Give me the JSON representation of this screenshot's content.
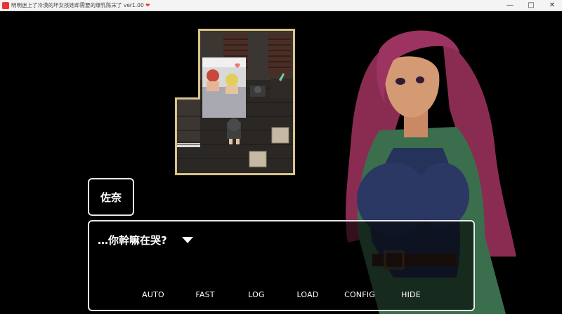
{
  "window": {
    "title": "明明迷上了冷漠的坏女孩她却需要的爆乳陈宋了 ver1.00",
    "heart": "❤",
    "minimize": "—",
    "maximize": "□",
    "close": "✕"
  },
  "dialogue": {
    "speaker": "佐奈",
    "text": "…你幹嘛在哭?"
  },
  "menu": {
    "items": [
      "AUTO",
      "FAST",
      "LOG",
      "LOAD",
      "CONFIG",
      "HIDE"
    ]
  },
  "colors": {
    "room_border": "#d8c48a",
    "wall": "#3b3632",
    "floor": "#2a2724",
    "hair": "#8a2c52",
    "jacket": "#3a6e4c",
    "top": "#25325a"
  }
}
